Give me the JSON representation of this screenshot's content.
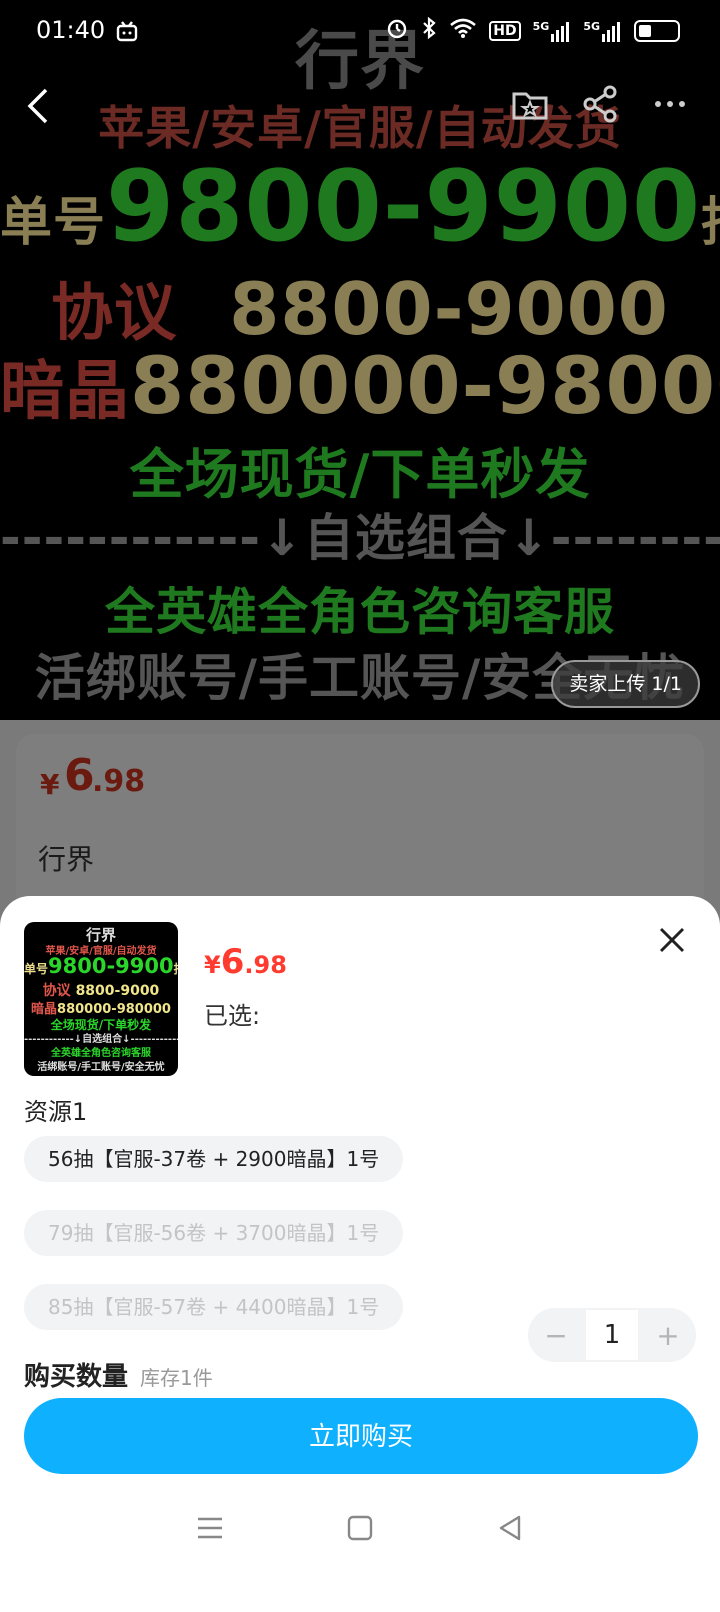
{
  "status_bar": {
    "time": "01:40",
    "network": "5G",
    "hd": "HD"
  },
  "hero": {
    "title": "行界",
    "line1": "苹果/安卓/官服/自动发货",
    "line2_left": "单号",
    "line2_mid": "9800-9900",
    "line2_right": "抽",
    "line3_left": "协议",
    "line3_mid": "8800-9000",
    "line4_left": "暗晶",
    "line4_mid": "880000-980000",
    "line5": "全场现货/下单秒发",
    "line6": "------------↓自选组合↓------------",
    "line7": "全英雄全角色咨询客服",
    "line8": "活绑账号/手工账号/安全无忧",
    "upload_badge": "卖家上传 1/1"
  },
  "product": {
    "currency": "¥",
    "price_int": "6",
    "price_dec": ".98",
    "name": "行界"
  },
  "sheet": {
    "currency": "¥",
    "price_int": "6",
    "price_dec": ".98",
    "selected_label": "已选:",
    "group_label": "资源1",
    "options": [
      {
        "label": "56抽【官服-37卷 + 2900暗晶】1号",
        "enabled": true
      },
      {
        "label": "79抽【官服-56卷 + 3700暗晶】1号",
        "enabled": false
      },
      {
        "label": "85抽【官服-57卷 + 4400暗晶】1号",
        "enabled": false
      }
    ],
    "quantity_label": "购买数量",
    "stock_label": "库存1件",
    "quantity": "1",
    "minus": "−",
    "plus": "+",
    "buy_label": "立即购买"
  },
  "colors": {
    "buy_button": "#0fb1ff",
    "price": "#ff3b30",
    "option_bg": "#f2f3f5"
  }
}
